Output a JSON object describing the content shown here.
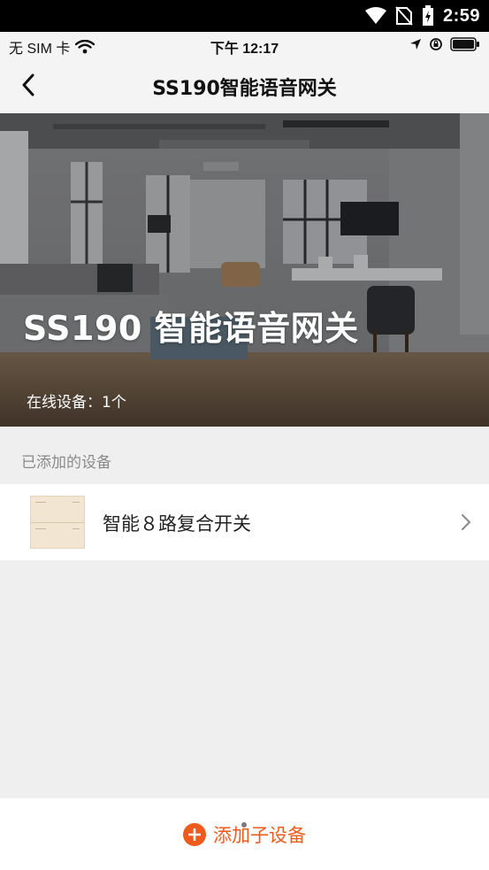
{
  "system_bar": {
    "time": "2:59"
  },
  "ios_status": {
    "carrier": "无 SIM 卡",
    "time": "下午 12:17"
  },
  "nav": {
    "title": "SS190智能语音网关"
  },
  "hero": {
    "title": "SS190 智能语音网关",
    "online_label": "在线设备：",
    "online_count": "1个"
  },
  "section": {
    "label": "已添加的设备"
  },
  "devices": [
    {
      "name": "智能８路复合开关"
    }
  ],
  "bottom": {
    "add_label": "添加子设备"
  },
  "colors": {
    "accent": "#ef5a1d"
  }
}
